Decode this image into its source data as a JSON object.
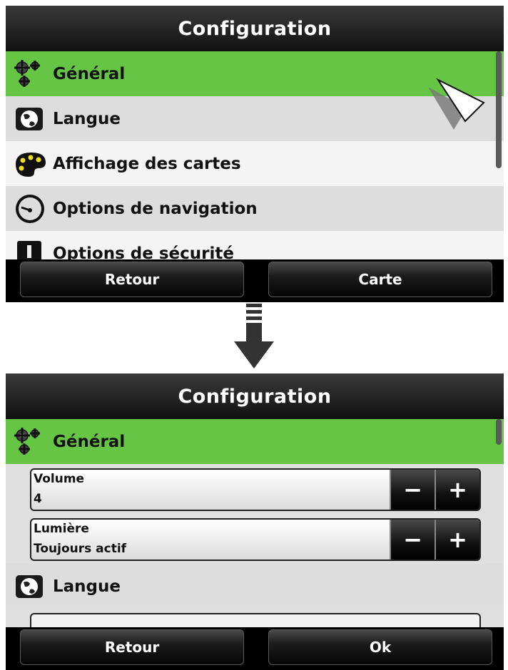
{
  "before": {
    "title": "Configuration",
    "menu": [
      {
        "label": "Général",
        "icon": "gears-icon",
        "state": "selected"
      },
      {
        "label": "Langue",
        "icon": "globe-icon",
        "state": "normal"
      },
      {
        "label": "Affichage des cartes",
        "icon": "palette-icon",
        "state": "normal"
      },
      {
        "label": "Options de navigation",
        "icon": "speedometer-icon",
        "state": "normal"
      },
      {
        "label": "Options de sécurité",
        "icon": "warning-icon",
        "state": "normal"
      }
    ],
    "buttons": {
      "back": "Retour",
      "map": "Carte"
    }
  },
  "after": {
    "title": "Configuration",
    "section_general": {
      "label": "Général",
      "icon": "gears-icon"
    },
    "settings": [
      {
        "label": "Volume",
        "value": "4",
        "minus": "−",
        "plus": "+"
      },
      {
        "label": "Lumière",
        "value": "Toujours actif",
        "minus": "−",
        "plus": "+"
      }
    ],
    "section_langue": {
      "label": "Langue",
      "icon": "globe-icon"
    },
    "buttons": {
      "back": "Retour",
      "ok": "Ok"
    }
  },
  "colors": {
    "selected": "#66c545",
    "titlebar": "#1a1a1a",
    "row_light": "#f4f4f4",
    "row_dark": "#dddddd"
  }
}
